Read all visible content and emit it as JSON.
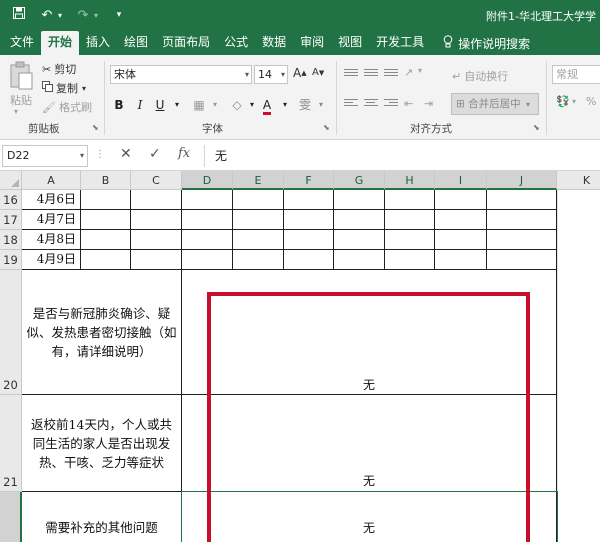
{
  "titlebar": {
    "title": "附件1-华北理工大学学",
    "icons": [
      "save-icon",
      "undo-icon",
      "redo-icon",
      "customize-icon"
    ]
  },
  "menu": {
    "tabs": [
      "文件",
      "开始",
      "插入",
      "绘图",
      "页面布局",
      "公式",
      "数据",
      "审阅",
      "视图",
      "开发工具"
    ],
    "active": "开始",
    "tell_me": "操作说明搜索"
  },
  "ribbon": {
    "clipboard": {
      "group_label": "剪贴板",
      "paste": "粘贴",
      "cut": "剪切",
      "copy": "复制",
      "format_painter": "格式刷"
    },
    "font": {
      "group_label": "字体",
      "font_name": "宋体",
      "font_size": "14",
      "grow": "A",
      "shrink": "A",
      "bold": "B",
      "italic": "I",
      "underline": "U",
      "font_color_letter": "A",
      "phonetic": "雯",
      "font_color": "#c8102e"
    },
    "alignment": {
      "group_label": "对齐方式",
      "wrap_text": "自动换行",
      "merge_center": "合并后居中"
    },
    "number": {
      "format": "常规"
    }
  },
  "formula_bar": {
    "name_box": "D22",
    "cancel": "✕",
    "enter": "✓",
    "fx": "fx",
    "content": "无"
  },
  "sheet": {
    "columns": [
      "A",
      "B",
      "C",
      "D",
      "E",
      "F",
      "G",
      "H",
      "I",
      "J",
      "K"
    ],
    "rows": [
      {
        "num": "16",
        "date": "4月6日"
      },
      {
        "num": "17",
        "date": "4月7日"
      },
      {
        "num": "18",
        "date": "4月8日"
      },
      {
        "num": "19",
        "date": "4月9日"
      },
      {
        "num": "20",
        "label": "是否与新冠肺炎确诊、疑似、发热患者密切接触（如有，请详细说明）",
        "value": "无"
      },
      {
        "num": "21",
        "label": "返校前14天内，个人或共同生活的家人是否出现发热、干咳、乏力等症状",
        "value": "无"
      },
      {
        "num": "",
        "label": "需要补充的其他问题",
        "value": "无"
      }
    ],
    "accent": "#217346",
    "annotation_color": "#c8102e"
  }
}
